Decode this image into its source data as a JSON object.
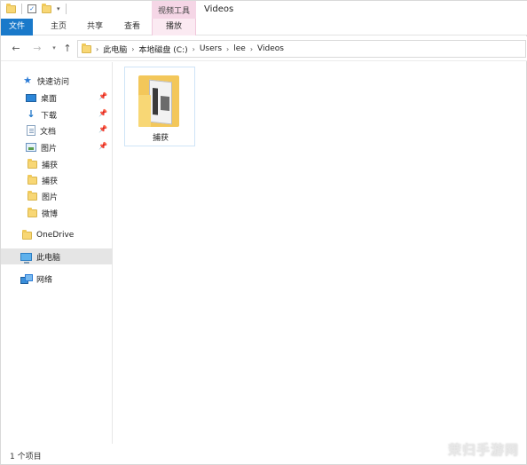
{
  "title_bar": {
    "context_group_label": "视频工具",
    "window_title": "Videos"
  },
  "ribbon": {
    "tabs": [
      {
        "label": "文件"
      },
      {
        "label": "主页"
      },
      {
        "label": "共享"
      },
      {
        "label": "查看"
      },
      {
        "label": "播放"
      }
    ]
  },
  "address_bar": {
    "breadcrumbs": [
      "此电脑",
      "本地磁盘 (C:)",
      "Users",
      "lee",
      "Videos"
    ]
  },
  "nav_pane": {
    "quick_access": "快速访问",
    "pinned": [
      {
        "label": "桌面",
        "icon": "desktop-icon"
      },
      {
        "label": "下载",
        "icon": "download-icon"
      },
      {
        "label": "文档",
        "icon": "document-icon"
      },
      {
        "label": "图片",
        "icon": "pictures-icon"
      }
    ],
    "recent": [
      {
        "label": "捕获",
        "icon": "folder-icon"
      },
      {
        "label": "捕获",
        "icon": "folder-icon"
      },
      {
        "label": "图片",
        "icon": "folder-icon"
      },
      {
        "label": "微博",
        "icon": "folder-icon"
      }
    ],
    "onedrive": "OneDrive",
    "this_pc": "此电脑",
    "network": "网络"
  },
  "content": {
    "items": [
      {
        "name": "捕获",
        "icon": "folder-icon"
      }
    ]
  },
  "status_bar": {
    "item_count": "1 个项目"
  },
  "watermark": "茉归手游网",
  "colors": {
    "file_tab_bg": "#1979ca",
    "context_tab_bg": "#f5d6e6",
    "selection_bg": "#e5e5e5",
    "folder": "#f8d775"
  }
}
